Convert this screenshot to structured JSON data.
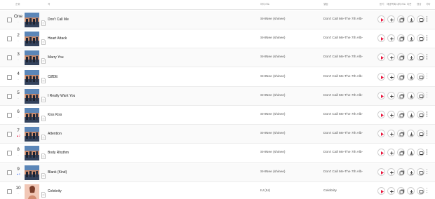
{
  "header": {
    "rank": "순위",
    "title": "곡",
    "artist": "아티스트",
    "album": "앨범",
    "listen": "듣기",
    "add_to_playlist": "재생목록",
    "add_to_my_list": "내리스트",
    "download": "다운",
    "video": "영상",
    "more": "기타"
  },
  "colors": {
    "play_accent": "#e8143c",
    "rank_up": "#e8143c",
    "rank_down": "#3e6ef2"
  },
  "tracks": [
    {
      "rank": "One",
      "change": "-",
      "change_dir": "none",
      "title": "Don't Call Me",
      "artist": "SHINee (shinee)",
      "album": "Don't Call Me-The 7th Alb-",
      "art": "shinee"
    },
    {
      "rank": "2",
      "change": "-",
      "change_dir": "none",
      "title": "Heart Attack",
      "artist": "SHINee (shinee)",
      "album": "Don't Call Me-The 7th Alb-",
      "art": "shinee"
    },
    {
      "rank": "3",
      "change": "-",
      "change_dir": "none",
      "title": "Marry You",
      "artist": "SHINee (shinee)",
      "album": "Don't Call Me-The 7th Alb-",
      "art": "shinee"
    },
    {
      "rank": "4",
      "change": "-",
      "change_dir": "none",
      "title": "CØDE",
      "artist": "SHINee (shinee)",
      "album": "Don't Call Me-The 7th Alb-",
      "art": "shinee"
    },
    {
      "rank": "5",
      "change": "-",
      "change_dir": "none",
      "title": "I Really Want You",
      "artist": "SHINee (shinee)",
      "album": "Don't Call Me-The 7th Alb-",
      "art": "shinee"
    },
    {
      "rank": "6",
      "change": "-",
      "change_dir": "none",
      "title": "Kiss Kiss",
      "artist": "SHINee (shinee)",
      "album": "Don't Call Me-The 7th Alb-",
      "art": "shinee"
    },
    {
      "rank": "7",
      "change": "▲2",
      "change_dir": "up",
      "title": "Attention",
      "artist": "SHINee (shinee)",
      "album": "Don't Call Me-The 7th Alb-",
      "art": "shinee"
    },
    {
      "rank": "8",
      "change": "-",
      "change_dir": "none",
      "title": "Body Rhythm",
      "artist": "SHINee (shinee)",
      "album": "Don't Call Me-The 7th Alb-",
      "art": "shinee"
    },
    {
      "rank": "9",
      "change": "▼2",
      "change_dir": "down",
      "title": "Blank (Kind)",
      "artist": "SHINee (shinee)",
      "album": "Don't Call Me-The 7th Alb-",
      "art": "shinee"
    },
    {
      "rank": "10",
      "change": "-",
      "change_dir": "none",
      "title": "Celebrity",
      "artist": "IU (IU)",
      "album": "Celebrity",
      "art": "iu"
    }
  ],
  "action_icons": [
    "play-icon",
    "plus-icon",
    "add-list-icon",
    "download-icon",
    "video-icon",
    "more-icon"
  ]
}
